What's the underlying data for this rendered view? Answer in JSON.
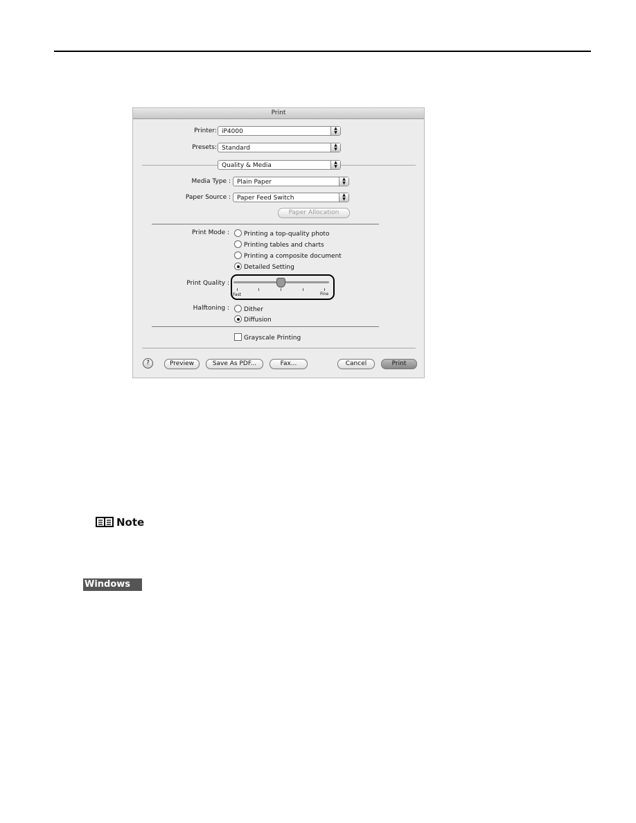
{
  "dialog": {
    "title": "Print",
    "printer_label": "Printer:",
    "printer_value": "iP4000",
    "presets_label": "Presets:",
    "presets_value": "Standard",
    "panel_value": "Quality & Media",
    "media_type_label": "Media Type :",
    "media_type_value": "Plain Paper",
    "paper_source_label": "Paper Source :",
    "paper_source_value": "Paper Feed Switch",
    "paper_allocation_button": "Paper Allocation",
    "print_mode_label": "Print Mode :",
    "print_mode_options": [
      "Printing a top-quality photo",
      "Printing tables and charts",
      "Printing a composite document",
      "Detailed Setting"
    ],
    "print_mode_selected": "Detailed Setting",
    "print_quality_label": "Print Quality :",
    "print_quality_min": "Fast",
    "print_quality_max": "Fine",
    "print_quality_level": 3,
    "print_quality_steps": 5,
    "halftoning_label": "Halftoning :",
    "halftoning_options": [
      "Dither",
      "Diffusion"
    ],
    "halftoning_selected": "Diffusion",
    "grayscale_label": "Grayscale Printing",
    "grayscale_checked": false,
    "help_button": "?",
    "preview_button": "Preview",
    "save_pdf_button": "Save As PDF...",
    "fax_button": "Fax...",
    "cancel_button": "Cancel",
    "print_button": "Print"
  },
  "note": {
    "label": "Note",
    "icon": "book-icon"
  },
  "windows_logo": {
    "text": "Windows"
  }
}
